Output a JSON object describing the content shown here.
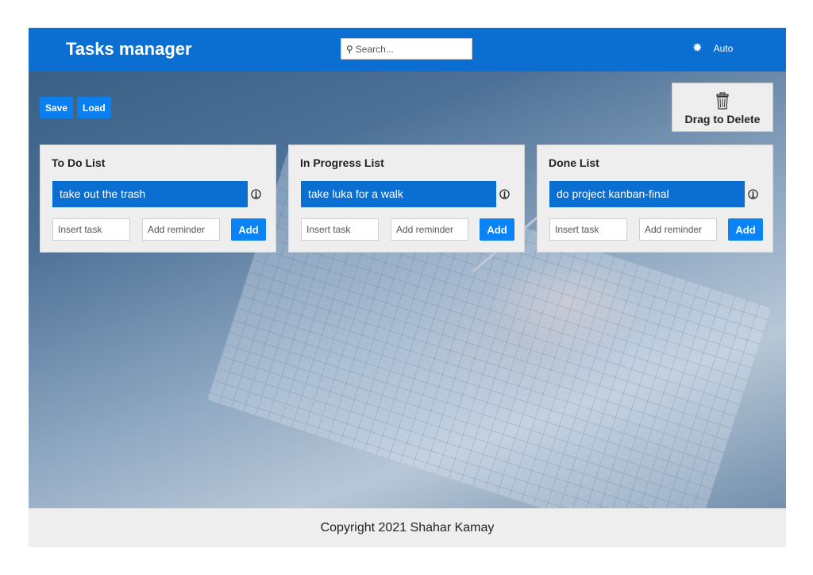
{
  "header": {
    "title": "Tasks manager",
    "search_placeholder": "Search...",
    "theme_label": "Auto",
    "colors": {
      "header_bg": "#0a6fd0",
      "button_bg": "#0a7ff0"
    }
  },
  "toolbar": {
    "save_label": "Save",
    "load_label": "Load"
  },
  "delete_zone": {
    "label": "Drag to Delete",
    "icon": "trash-icon"
  },
  "lists": [
    {
      "title": "To Do List",
      "tasks": [
        "take out the trash"
      ],
      "task_placeholder": "Insert task",
      "reminder_placeholder": "Add reminder",
      "add_label": "Add"
    },
    {
      "title": "In Progress List",
      "tasks": [
        "take luka for a walk"
      ],
      "task_placeholder": "Insert task",
      "reminder_placeholder": "Add reminder",
      "add_label": "Add"
    },
    {
      "title": "Done List",
      "tasks": [
        "do project kanban-final"
      ],
      "task_placeholder": "Insert task",
      "reminder_placeholder": "Add reminder",
      "add_label": "Add"
    }
  ],
  "footer": {
    "text": "Copyright 2021 Shahar Kamay"
  }
}
